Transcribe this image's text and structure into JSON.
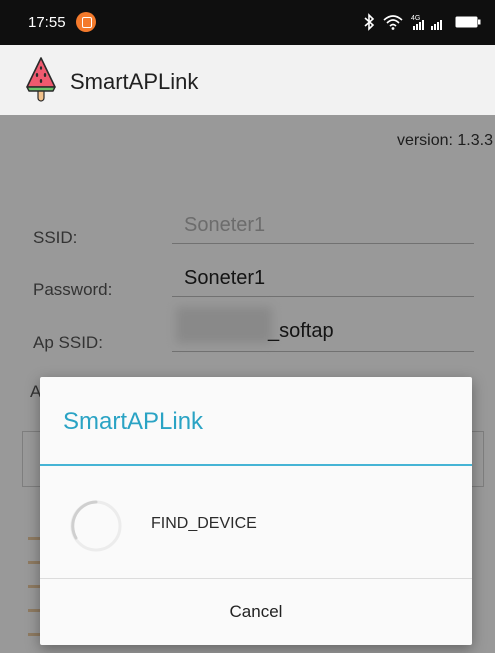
{
  "status_bar": {
    "time": "17:55",
    "network": "4G"
  },
  "app": {
    "title": "SmartAPLink",
    "version_text": "version: 1.3.3"
  },
  "form": {
    "ssid_label": "SSID:",
    "ssid_value": "Soneter1",
    "password_label": "Password:",
    "password_value": "Soneter1",
    "ap_ssid_label": "Ap SSID:",
    "ap_ssid_value": "_softap",
    "partial_label": "A"
  },
  "dialog": {
    "title": "SmartAPLink",
    "message": "FIND_DEVICE",
    "cancel_label": "Cancel"
  },
  "colors": {
    "accent": "#2aa3c4",
    "status_dot": "#f47a2c"
  }
}
